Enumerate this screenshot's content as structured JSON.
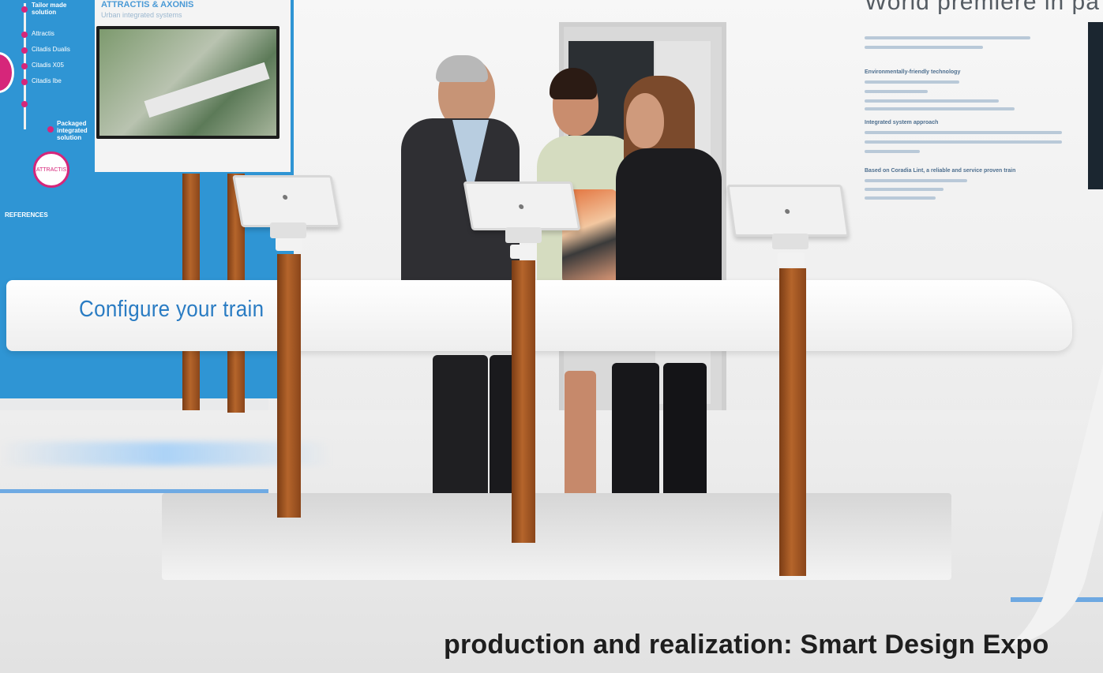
{
  "scene": {
    "board_title": "ATTRACTIS & AXONIS",
    "board_subtitle": "Urban integrated systems",
    "timeline": [
      {
        "label": "Tailor made solution",
        "strong": true
      },
      {
        "label": "Attractis",
        "strong": false
      },
      {
        "label": "Citadis Dualis",
        "strong": false
      },
      {
        "label": "Citadis X05",
        "strong": false
      },
      {
        "label": "Citadis Ibe",
        "strong": false
      },
      {
        "label": "Packaged integrated solution",
        "strong": true
      },
      {
        "label": "REFERENCES",
        "strong": true
      }
    ],
    "badge_text": "ATTRACTIS",
    "wall_title": "World premiere in pa",
    "wall_blocks": [
      "Environmentally-friendly technology",
      "Integrated system approach",
      "Based on Coradia Lint, a reliable and service proven train"
    ],
    "counter_label": "Configure your train"
  },
  "caption": "production and realization: Smart Design Expo",
  "colors": {
    "panel_blue": "#2f95d4",
    "accent_magenta": "#d6267a",
    "counter_text_blue": "#2a7cc3",
    "wood": "#b5652b"
  }
}
